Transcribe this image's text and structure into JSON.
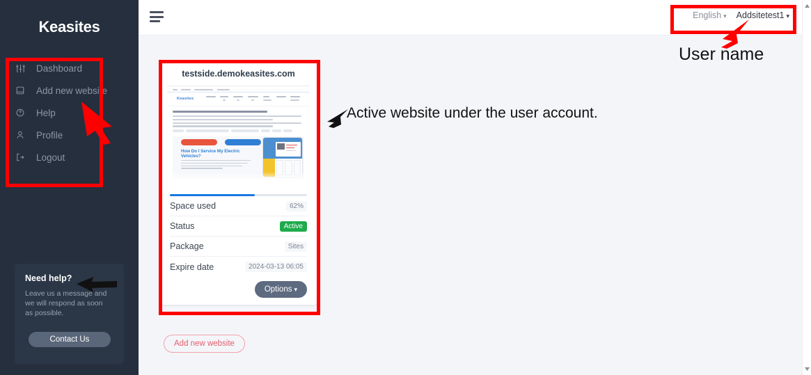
{
  "sidebar": {
    "brand": "Keasites",
    "items": [
      {
        "label": "Dashboard",
        "icon": "sliders-icon"
      },
      {
        "label": "Add new website",
        "icon": "browser-window-icon"
      },
      {
        "label": "Help",
        "icon": "question-circle-icon"
      },
      {
        "label": "Profile",
        "icon": "person-icon"
      },
      {
        "label": "Logout",
        "icon": "logout-arrow-icon"
      }
    ],
    "help_card": {
      "title": "Need help?",
      "text": "Leave us a message and we will respond as soon as possible.",
      "button": "Contact Us"
    }
  },
  "topbar": {
    "menu_icon": "hamburger-icon",
    "language": "English",
    "user": "Addsitetest1"
  },
  "main": {
    "site_card": {
      "domain": "testside.demokeasites.com",
      "preview": {
        "logo": "Keasites",
        "hero_heading": "How Do I Service My Electric Vehicles?"
      },
      "space_used_percent": 62,
      "rows": [
        {
          "label": "Space used",
          "value": "62%",
          "type": "plain"
        },
        {
          "label": "Status",
          "value": "Active",
          "type": "badge"
        },
        {
          "label": "Package",
          "value": "Sites",
          "type": "plain"
        },
        {
          "label": "Expire date",
          "value": "2024-03-13 06:05",
          "type": "plain"
        }
      ],
      "options_button": "Options"
    },
    "add_website_button": "Add new website"
  },
  "annotations": {
    "user_name": "User name",
    "active_website": "Active website under the user account.",
    "highlight_color": "#ff0000"
  },
  "colors": {
    "sidebar_bg": "#252f3e",
    "main_bg": "#f4f5f9",
    "accent_blue": "#1878e3",
    "status_green": "#1eab4b",
    "add_btn_red": "#e35d6a",
    "options_slate": "#5d6a80"
  },
  "scrollbar": {
    "up_arrow": "scroll-up-arrow-icon",
    "down_arrow": "scroll-down-arrow-icon"
  }
}
